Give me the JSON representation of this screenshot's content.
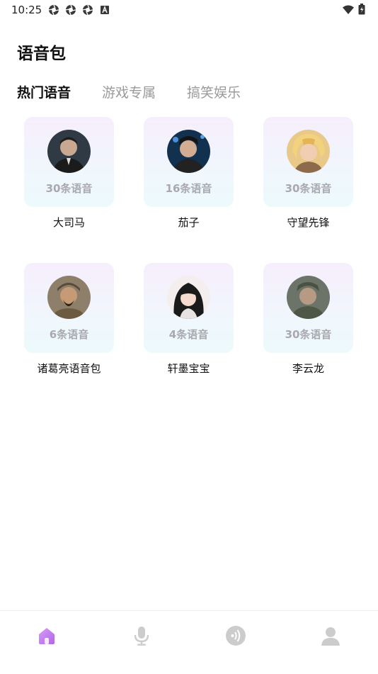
{
  "status_bar": {
    "time": "10:25",
    "icons": [
      "aperture-icon",
      "aperture-icon",
      "aperture-icon",
      "a-badge-icon"
    ],
    "right_icons": [
      "wifi-icon",
      "battery-icon"
    ]
  },
  "header": {
    "title": "语音包"
  },
  "tabs": [
    {
      "label": "热门语音",
      "active": true
    },
    {
      "label": "游戏专属",
      "active": false
    },
    {
      "label": "搞笑娱乐",
      "active": false
    }
  ],
  "cards": [
    {
      "name": "大司马",
      "count": "30条语音",
      "avatar": "man-portrait-dark"
    },
    {
      "name": "茄子",
      "count": "16条语音",
      "avatar": "man-portrait-blue"
    },
    {
      "name": "守望先锋",
      "count": "30条语音",
      "avatar": "game-hero-blonde"
    },
    {
      "name": "诸葛亮语音包",
      "count": "6条语音",
      "avatar": "ancient-strategist"
    },
    {
      "name": "轩墨宝宝",
      "count": "4条语音",
      "avatar": "girl-portrait"
    },
    {
      "name": "李云龙",
      "count": "30条语音",
      "avatar": "soldier-portrait"
    }
  ],
  "bottom_nav": [
    {
      "icon": "home-icon",
      "active": true
    },
    {
      "icon": "microphone-icon",
      "active": false
    },
    {
      "icon": "sound-icon",
      "active": false
    },
    {
      "icon": "profile-icon",
      "active": false
    }
  ],
  "colors": {
    "accent": "#c57cf3",
    "inactive_icon": "#cccccc",
    "muted_text": "#a9a9ad"
  }
}
